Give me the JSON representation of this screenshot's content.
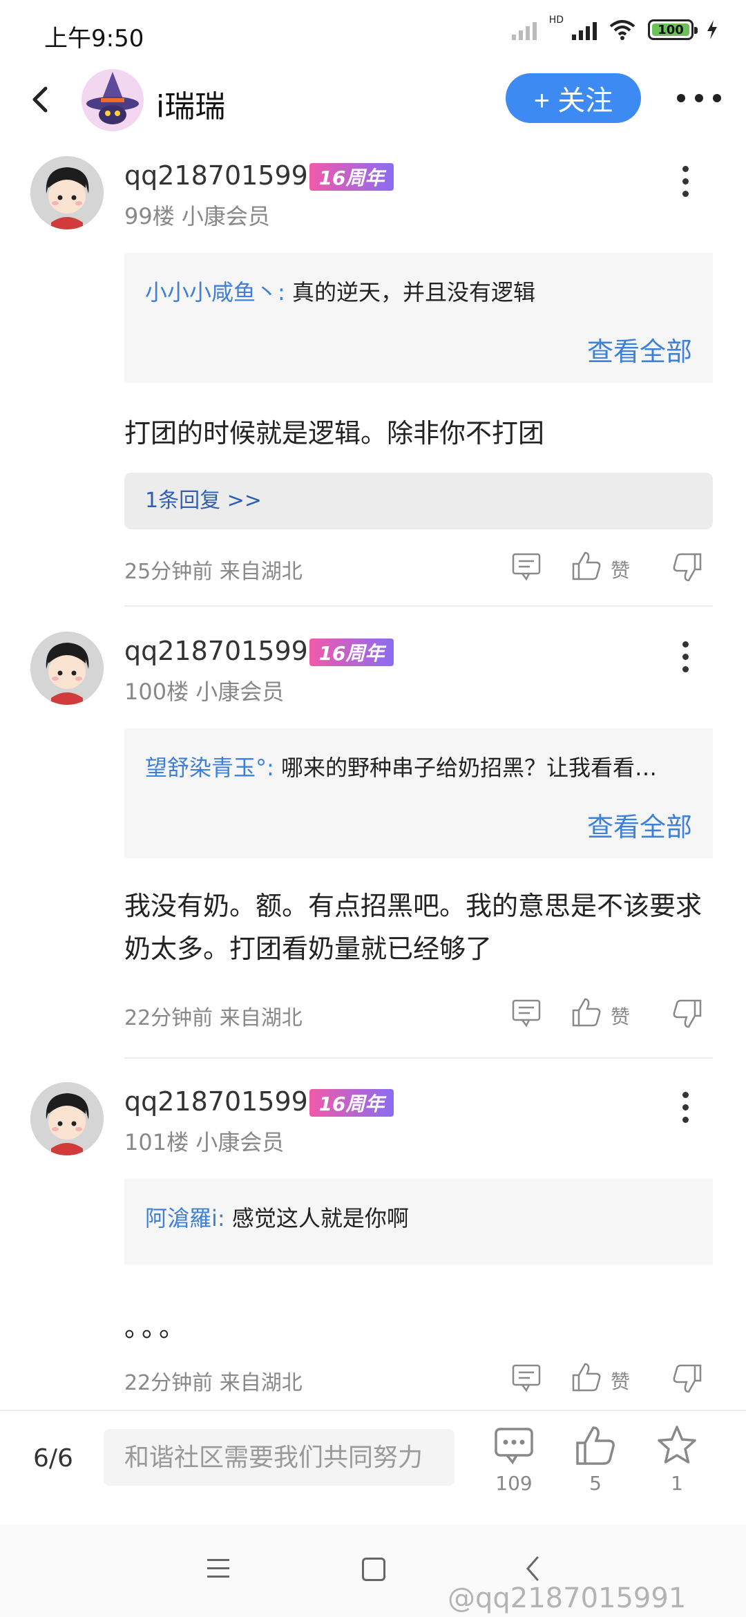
{
  "status_bar": {
    "time": "上午9:50",
    "network_label": "HD",
    "battery": "100"
  },
  "header": {
    "name": "i瑞瑞",
    "follow_label": "+ 关注"
  },
  "posts": [
    {
      "username": "qq2187015991",
      "badge": "16周年",
      "meta": "99楼 小康会员",
      "quote": {
        "author": "小小小咸鱼丶:",
        "text": "真的逆天，并且没有逻辑",
        "view_all": "查看全部"
      },
      "content": "打团的时候就是逻辑。除非你不打团",
      "replies": "1条回复 >>",
      "time": "25分钟前 来自湖北",
      "like_label": "赞"
    },
    {
      "username": "qq2187015991",
      "badge": "16周年",
      "meta": "100楼 小康会员",
      "quote": {
        "author": "望舒染青玉°:",
        "text": "哪来的野种串子给奶招黑？让我看看…",
        "view_all": "查看全部"
      },
      "content": "我没有奶。额。有点招黑吧。我的意思是不该要求奶太多。打团看奶量就已经够了",
      "time": "22分钟前 来自湖北",
      "like_label": "赞"
    },
    {
      "username": "qq2187015991",
      "badge": "16周年",
      "meta": "101楼 小康会员",
      "quote": {
        "author": "阿滄羅i:",
        "text": "感觉这人就是你啊"
      },
      "content": "。。。",
      "time": "22分钟前 来自湖北",
      "like_label": "赞"
    }
  ],
  "bottom_bar": {
    "page_indicator": "6/6",
    "input_placeholder": "和谐社区需要我们共同努力",
    "comment_count": "109",
    "like_count": "5",
    "favorite_count": "1"
  },
  "watermark": "@qq2187015991",
  "colors": {
    "accent": "#3d8bf2",
    "link": "#3d7fd9",
    "badge_start": "#f15aa8",
    "badge_end": "#8a6cf2"
  }
}
